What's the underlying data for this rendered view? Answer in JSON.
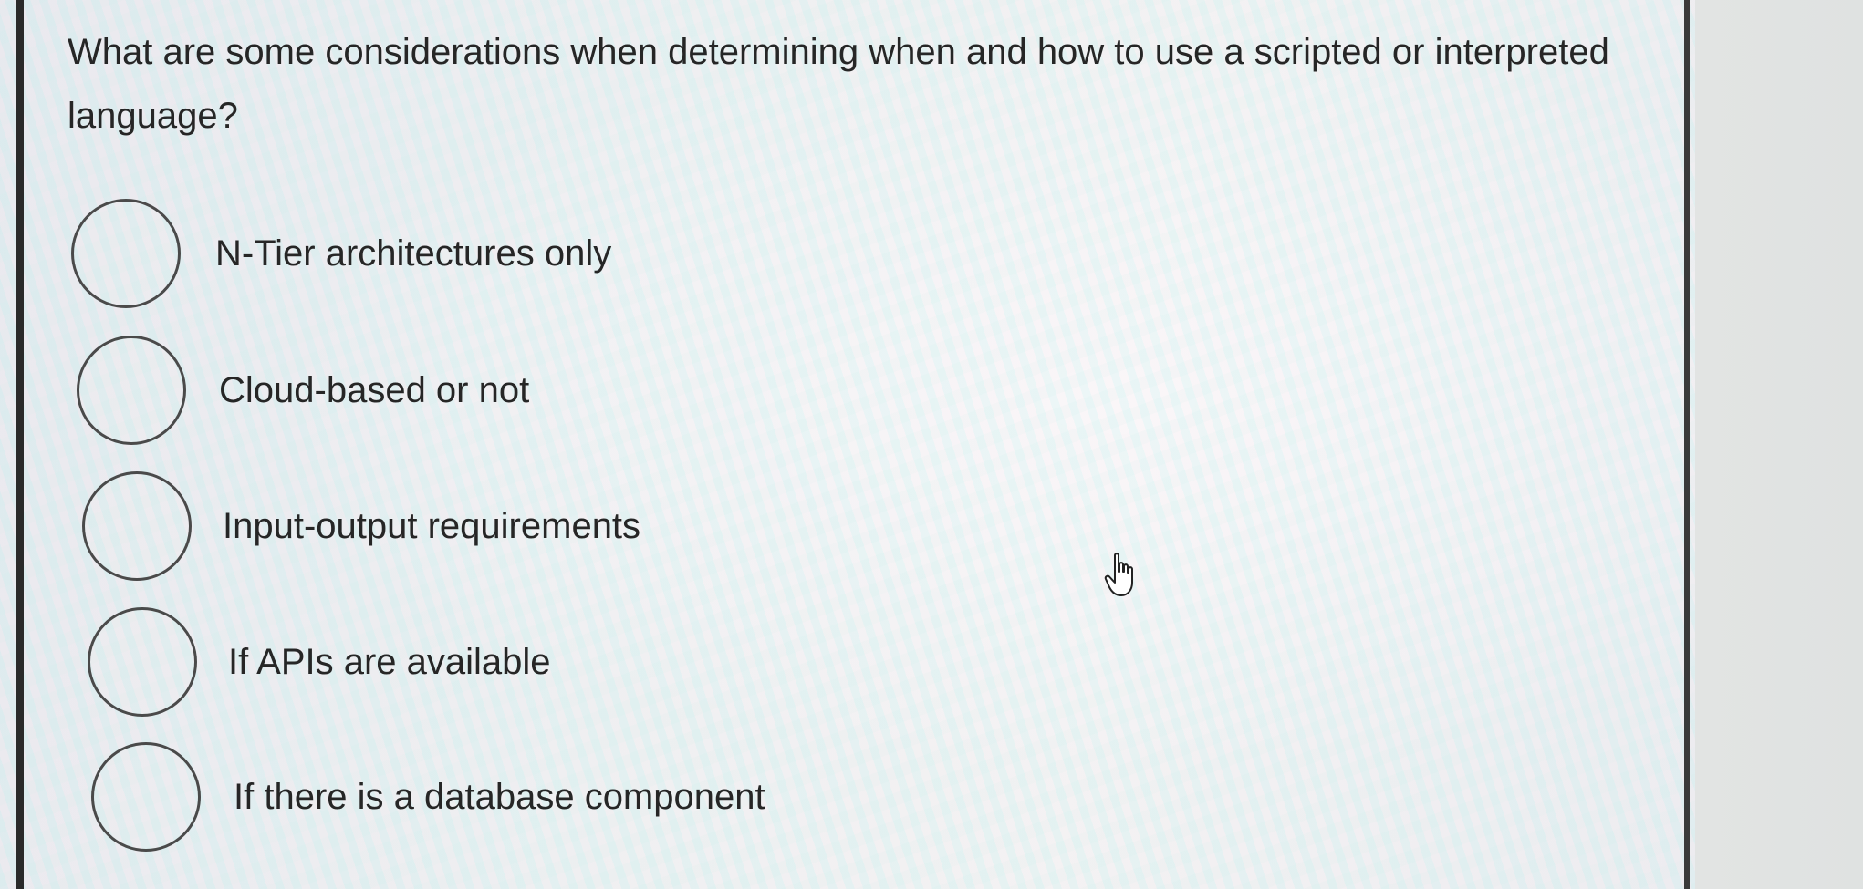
{
  "question": {
    "text": "What are some considerations when determining when and how to use a scripted or interpreted language?"
  },
  "options": [
    {
      "label": "N-Tier architectures only",
      "selected": false
    },
    {
      "label": "Cloud-based or not",
      "selected": false
    },
    {
      "label": "Input-output requirements",
      "selected": false
    },
    {
      "label": "If APIs are available",
      "selected": false
    },
    {
      "label": "If there is a database component",
      "selected": false
    }
  ],
  "cursor": {
    "icon": "hand-pointer-icon"
  },
  "colors": {
    "text": "#262626",
    "radio_border": "#4a4a4a",
    "card_border": "#2a2a2a"
  }
}
